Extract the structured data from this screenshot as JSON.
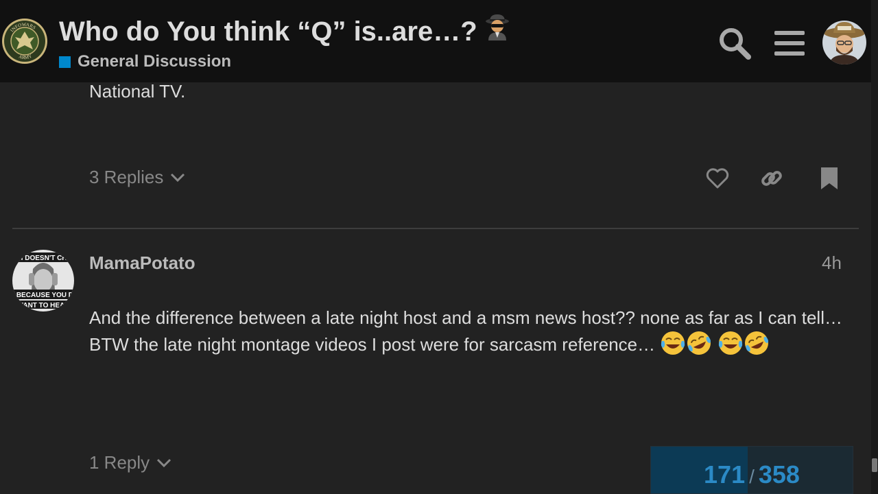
{
  "header": {
    "title": "Who do You think “Q” is..are…?",
    "title_emoji": "detective-icon",
    "category": {
      "name": "General Discussion",
      "color": "#0088cc"
    },
    "logo_texts": [
      "INFOWARS",
      "ARMY"
    ],
    "icons": {
      "search": "search-icon",
      "menu": "hamburger-menu-icon",
      "user": "user-avatar"
    }
  },
  "previous_post": {
    "text_tail": "National TV.",
    "replies_label": "3 Replies",
    "actions": [
      "heart-icon",
      "link-icon",
      "bookmark-icon"
    ]
  },
  "post": {
    "username": "MamaPotato",
    "date": "4h",
    "avatar_text": [
      "TRUTH DOESN'T CHANGE",
      "JUST BECAUSE YOU DON'T",
      "WANT TO HEAR"
    ],
    "body": "And the difference between a late night host and a msm news host?? none as far as I can tell… BTW the late night montage videos I post were for sarcasm reference…",
    "emojis": [
      "joy-emoji",
      "rofl-emoji",
      "joy-emoji",
      "rofl-emoji"
    ],
    "replies_label": "1 Reply"
  },
  "progress": {
    "current": "171",
    "total": "358",
    "separator": "/",
    "fraction": 0.478
  },
  "colors": {
    "background": "#222222",
    "header": "#111111",
    "accent": "#0088cc"
  }
}
